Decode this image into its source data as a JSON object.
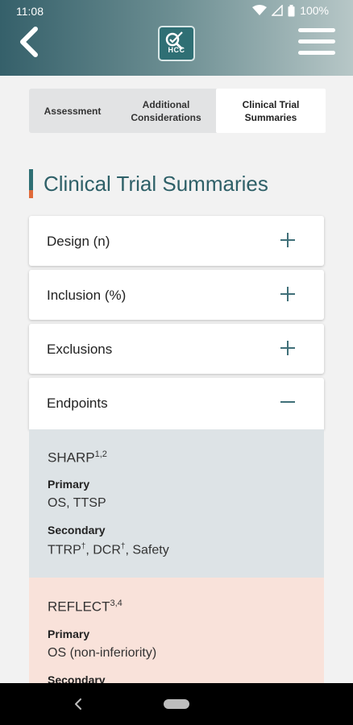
{
  "status_bar": {
    "time": "11:08",
    "battery": "100%"
  },
  "app_bar": {
    "logo_text": "HCC"
  },
  "tabs": [
    {
      "label": "Assessment",
      "active": false
    },
    {
      "label": "Additional Considerations",
      "active": false
    },
    {
      "label": "Clinical Trial Summaries",
      "active": true
    }
  ],
  "section_title": "Clinical Trial Summaries",
  "accordions": [
    {
      "label": "Design (n)",
      "expanded": false
    },
    {
      "label": "Inclusion (%)",
      "expanded": false
    },
    {
      "label": "Exclusions",
      "expanded": false
    },
    {
      "label": "Endpoints",
      "expanded": true
    }
  ],
  "endpoints": [
    {
      "trial": "SHARP",
      "ref": "1,2",
      "bg": "#dde3e6",
      "primary_label": "Primary",
      "primary": "OS, TTSP",
      "secondary_label": "Secondary",
      "secondary_parts": [
        "TTRP",
        "†",
        ", DCR",
        "†",
        ", Safety"
      ]
    },
    {
      "trial": "REFLECT",
      "ref": "3,4",
      "bg": "#f9e2da",
      "primary_label": "Primary",
      "primary": "OS (non-inferiority)",
      "secondary_label": "Secondary"
    }
  ],
  "colors": {
    "accent": "#2e6068",
    "orange": "#e06a3a",
    "toggle": "#3f6f78"
  }
}
